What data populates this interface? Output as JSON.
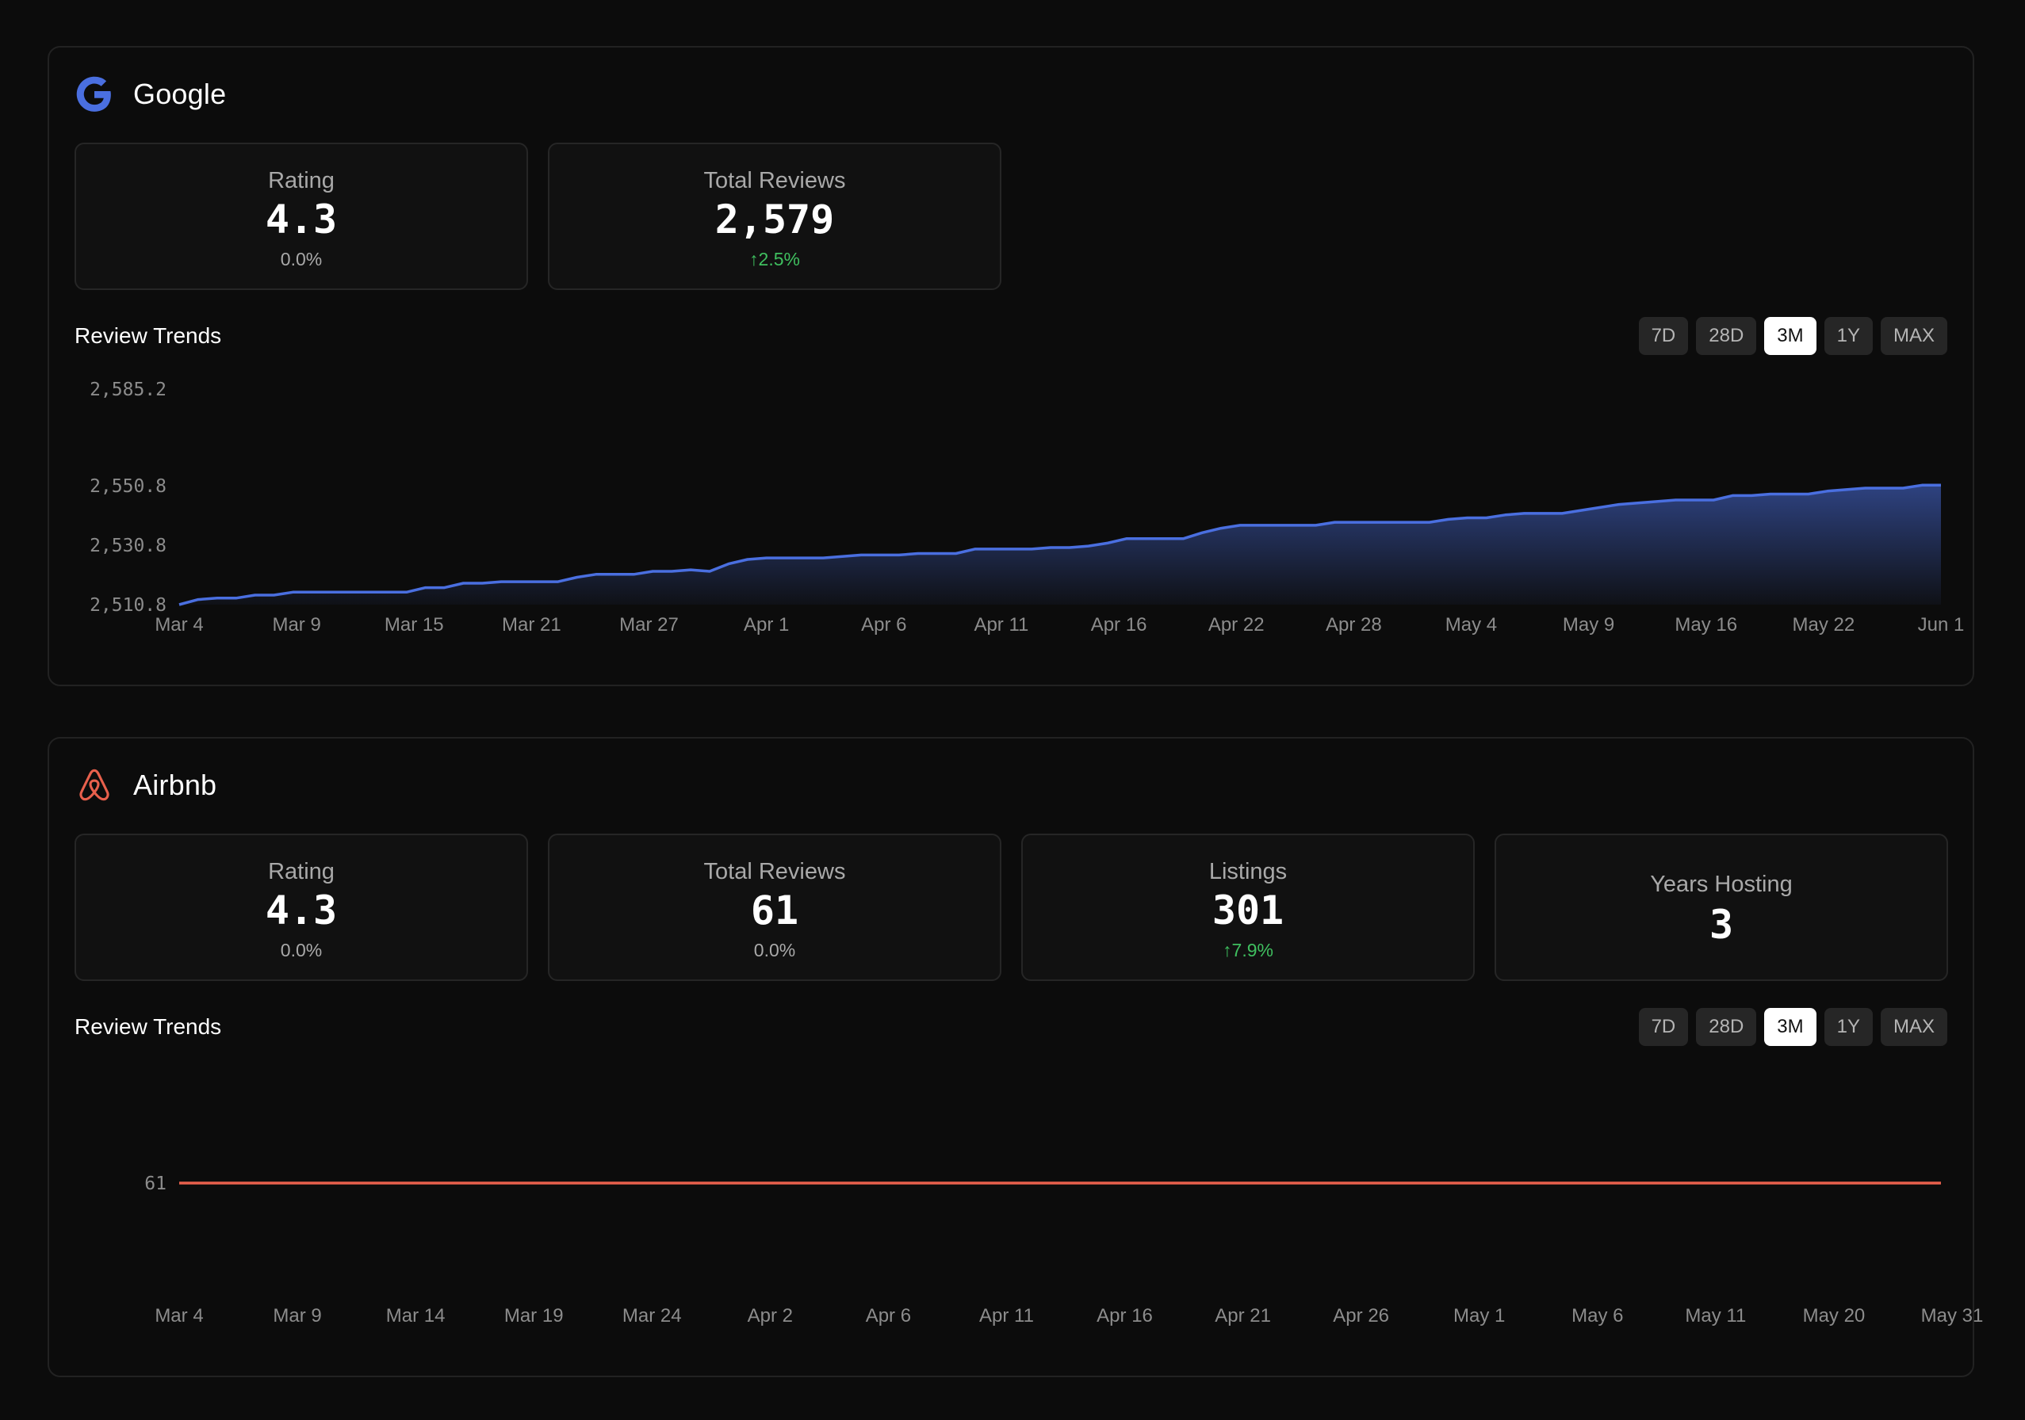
{
  "platforms": [
    {
      "id": "google",
      "name": "Google",
      "icon": "google-g-icon",
      "accent": "#4a6fe0",
      "stats": [
        {
          "label": "Rating",
          "value": "4.3",
          "change": "0.0%",
          "trend": "flat"
        },
        {
          "label": "Total Reviews",
          "value": "2,579",
          "change": "↑2.5%",
          "trend": "up"
        }
      ],
      "trends_title": "Review Trends",
      "ranges": [
        "7D",
        "28D",
        "3M",
        "1Y",
        "MAX"
      ],
      "active_range": "3M"
    },
    {
      "id": "airbnb",
      "name": "Airbnb",
      "icon": "airbnb-logo-icon",
      "accent": "#e8604c",
      "stats": [
        {
          "label": "Rating",
          "value": "4.3",
          "change": "0.0%",
          "trend": "flat"
        },
        {
          "label": "Total Reviews",
          "value": "61",
          "change": "0.0%",
          "trend": "flat"
        },
        {
          "label": "Listings",
          "value": "301",
          "change": "↑7.9%",
          "trend": "up"
        },
        {
          "label": "Years Hosting",
          "value": "3",
          "change": "",
          "trend": "none"
        }
      ],
      "trends_title": "Review Trends",
      "ranges": [
        "7D",
        "28D",
        "3M",
        "1Y",
        "MAX"
      ],
      "active_range": "3M"
    }
  ],
  "chart_data": [
    {
      "type": "area",
      "title": "Review Trends",
      "series": [
        {
          "values": [
            2510.8,
            2512.5,
            2513.0,
            2513.0,
            2514.0,
            2514.0,
            2515.0,
            2515.0,
            2515.0,
            2515.0,
            2515.0,
            2515.0,
            2515.0,
            2516.5,
            2516.5,
            2518.0,
            2518.0,
            2518.5,
            2518.5,
            2518.5,
            2518.5,
            2520.0,
            2521.0,
            2521.0,
            2521.0,
            2522.0,
            2522.0,
            2522.5,
            2522.0,
            2524.5,
            2526.0,
            2526.5,
            2526.5,
            2526.5,
            2526.5,
            2527.0,
            2527.5,
            2527.5,
            2527.5,
            2528.0,
            2528.0,
            2528.0,
            2529.5,
            2529.5,
            2529.5,
            2529.5,
            2530.0,
            2530.0,
            2530.5,
            2531.5,
            2533.0,
            2533.0,
            2533.0,
            2533.0,
            2535.0,
            2536.5,
            2537.5,
            2537.5,
            2537.5,
            2537.5,
            2537.5,
            2538.5,
            2538.5,
            2538.5,
            2538.5,
            2538.5,
            2538.5,
            2539.5,
            2540.0,
            2540.0,
            2541.0,
            2541.5,
            2541.5,
            2541.5,
            2542.5,
            2543.5,
            2544.5,
            2545.0,
            2545.5,
            2546.0,
            2546.0,
            2546.0,
            2547.5,
            2547.5,
            2548.0,
            2548.0,
            2548.0,
            2549.0,
            2549.5,
            2550.0,
            2550.0,
            2550.0,
            2551.0,
            2551.0
          ],
          "color": "#4a6fe0"
        }
      ],
      "x_labels": [
        "Mar 4",
        "Mar 9",
        "Mar 15",
        "Mar 21",
        "Mar 27",
        "Apr 1",
        "Apr 6",
        "Apr 11",
        "Apr 16",
        "Apr 22",
        "Apr 28",
        "May 4",
        "May 9",
        "May 16",
        "May 22",
        "Jun 1"
      ],
      "y_ticks": [
        "2,585.2",
        "2,550.8",
        "2,530.8",
        "2,510.8"
      ],
      "y_tick_values": [
        2585.2,
        2550.8,
        2530.8,
        2510.8
      ],
      "ylim": [
        2510.8,
        2585.2
      ],
      "y_scale": "nonlinear ticks",
      "grid": false,
      "legend": "none"
    },
    {
      "type": "line",
      "title": "Review Trends",
      "series": [
        {
          "values": [
            61,
            61,
            61,
            61,
            61,
            61,
            61,
            61,
            61,
            61,
            61,
            61,
            61,
            61,
            61,
            61
          ],
          "color": "#e8604c"
        }
      ],
      "x_labels": [
        "Mar 4",
        "Mar 9",
        "Mar 14",
        "Mar 19",
        "Mar 24",
        "Apr 2",
        "Apr 6",
        "Apr 11",
        "Apr 16",
        "Apr 21",
        "Apr 26",
        "May 1",
        "May 6",
        "May 11",
        "May 20",
        "May 31"
      ],
      "y_ticks": [
        "61"
      ],
      "y_tick_values": [
        61
      ],
      "grid": false,
      "legend": "none"
    }
  ]
}
